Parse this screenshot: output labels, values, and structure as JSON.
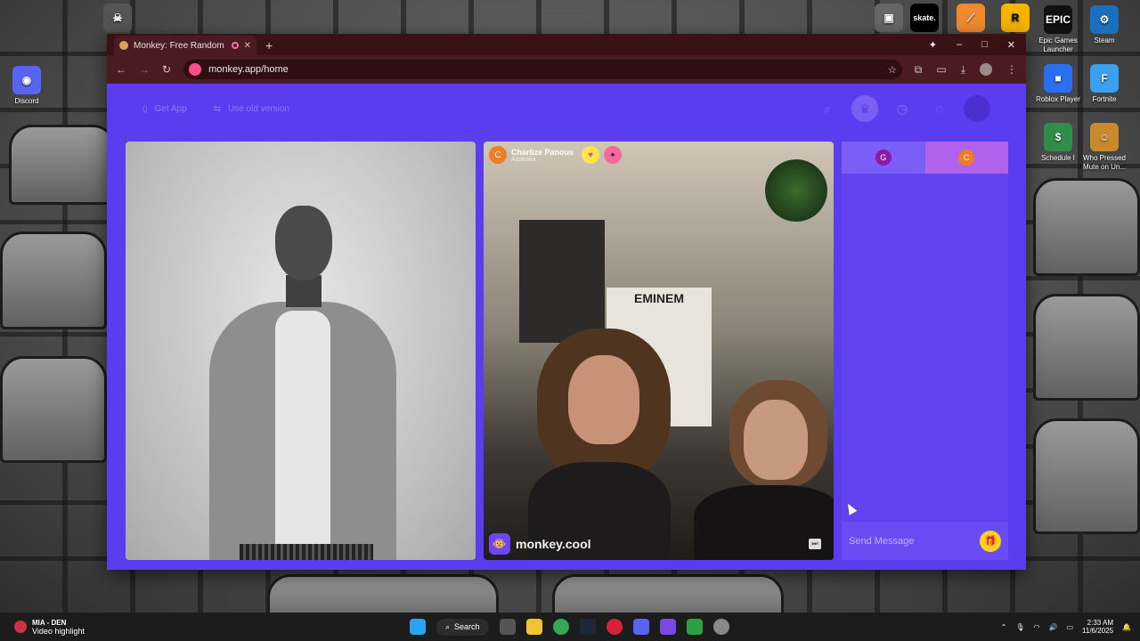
{
  "desktop": {
    "left_icons": [
      {
        "label": "Discord"
      }
    ],
    "right_icons": [
      {
        "label": "Epic Games Launcher"
      },
      {
        "label": "Steam"
      },
      {
        "label": "Roblox Player"
      },
      {
        "label": "Fortnite"
      },
      {
        "label": "Schedule I"
      },
      {
        "label": "Who Pressed Mute on Un..."
      }
    ],
    "top_icons": [
      {
        "label": "skate."
      }
    ]
  },
  "browser": {
    "tab_title": "Monkey: Free Random Vide",
    "url": "monkey.app/home",
    "new_tab_symbol": "+",
    "controls": {
      "minimize": "–",
      "maximize": "□",
      "close": "✕"
    }
  },
  "app": {
    "header": {
      "get_app": "Get App",
      "use_old_version": "Use old version"
    },
    "remote": {
      "avatar_letter": "C",
      "name": "Charlize Panous",
      "country": "Australia",
      "poster_text": "EMINEM",
      "watermark": "monkey.cool"
    },
    "chat": {
      "tab_g": "G",
      "tab_c": "C",
      "input_placeholder": "Send Message"
    }
  },
  "taskbar": {
    "highlight_title": "MIA - DEN",
    "highlight_subtitle": "Video highlight",
    "search_label": "Search",
    "time": "2:33 AM",
    "date": "11/6/2025"
  },
  "colors": {
    "app_bg": "#5b3df0",
    "chat_bg": "#6244ef",
    "tab_c_bg": "#b062ec"
  }
}
